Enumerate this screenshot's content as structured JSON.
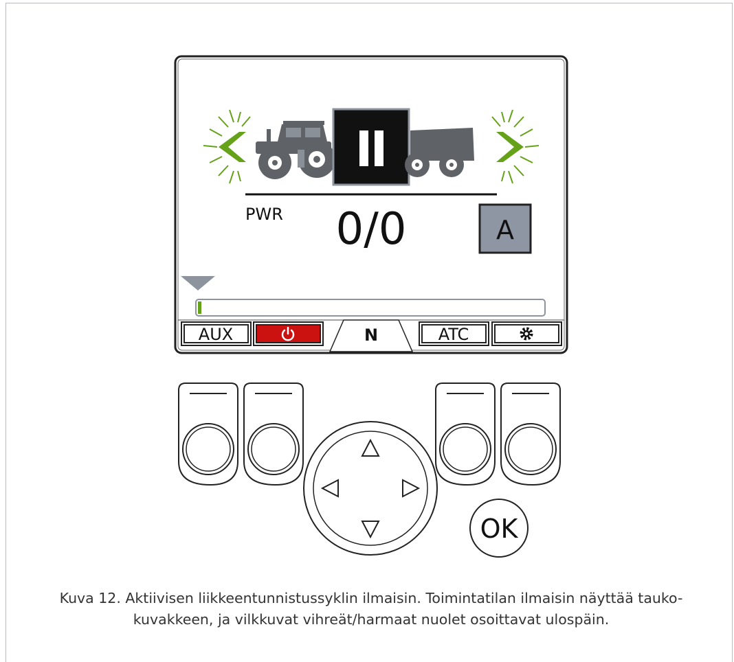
{
  "display": {
    "mode_label": "PWR",
    "counter": "0/0",
    "status_letter": "A",
    "progress": 0.01
  },
  "softkeys": {
    "aux": "AUX",
    "power_icon": "power-icon",
    "neutral": "N",
    "atc": "ATC",
    "settings_icon": "gear-icon"
  },
  "keypad": {
    "ok": "OK"
  },
  "caption": {
    "line1": "Kuva 12. Aktiivisen liikkeentunnistussyklin ilmaisin. Toimintatilan ilmaisin näyttää tauko-",
    "line2": "kuvakkeen, ja vilkkuvat vihreät/harmaat nuolet osoittavat ulospäin."
  },
  "colors": {
    "arrow_green": "#66a11a",
    "vehicle_gray": "#5f6368",
    "power_red": "#cc1111",
    "status_box": "#8f96a3",
    "pointer_gray": "#8d949e"
  }
}
